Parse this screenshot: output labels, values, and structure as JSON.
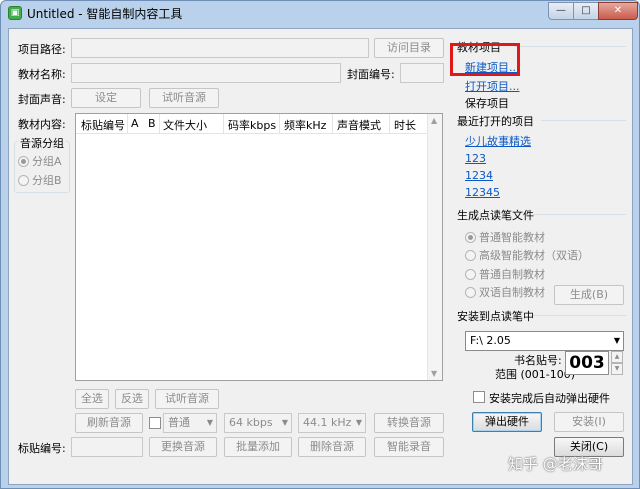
{
  "window": {
    "title": "Untitled - 智能自制内容工具",
    "min_glyph": "—",
    "max_glyph": "□",
    "close_glyph": "✕"
  },
  "left": {
    "project_path_label": "项目路径:",
    "visit_dir_button": "访问目录",
    "material_name_label": "教材名称:",
    "cover_code_label": "封面编号:",
    "cover_sound_label": "封面声音:",
    "set_button": "设定",
    "preview_button": "试听音源",
    "material_content_label": "教材内容:",
    "audio_group_title": "音源分组",
    "group_a": "分组A",
    "group_b": "分组B",
    "columns": [
      "标贴编号",
      "A",
      "B",
      "文件大小",
      "码率kbps",
      "频率kHz",
      "声音模式",
      "时长"
    ],
    "select_all_button": "全选",
    "invert_button": "反选",
    "preview_button2": "试听音源",
    "refresh_button": "刷新音源",
    "mode_select": "普通",
    "bitrate_select": "64 kbps",
    "freq_select": "44.1 kHz",
    "convert_button": "转换音源",
    "sticker_code_label": "标贴编号:",
    "replace_button": "更换音源",
    "batch_add_button": "批量添加",
    "delete_button": "删除音源",
    "smart_record_button": "智能录音"
  },
  "right": {
    "material_project_title": "教材项目",
    "new_project": "新建项目...",
    "open_project": "打开项目...",
    "save_project": "保存项目",
    "recent_title": "最近打开的项目",
    "recent": [
      "少儿故事精选",
      "123",
      "1234",
      "12345"
    ],
    "generate_title": "生成点读笔文件",
    "gen_options": [
      "普通智能教材",
      "高级智能教材（双语）",
      "普通自制教材",
      "双语自制教材"
    ],
    "generate_button": "生成(B)",
    "install_title": "安装到点读笔中",
    "drive_select": "F:\\ 2.05",
    "book_code_label": "书名贴号:",
    "range_label": "范围 (001-100)",
    "book_code_value": "003",
    "auto_eject_label": "安装完成后自动弹出硬件",
    "eject_button": "弹出硬件",
    "install_button": "安装(I)",
    "close_button": "关闭(C)"
  },
  "watermark": "知乎 @老沫哥",
  "colors": {
    "link": "#0b58c7",
    "highlight": "#e01818",
    "window_frame": "#b9d1ea",
    "client_bg": "#f0f0f0"
  },
  "icons": {
    "app": "app-icon",
    "dropdown": "chevron-down-icon",
    "spin_up": "spin-up-icon",
    "spin_down": "spin-down-icon"
  }
}
